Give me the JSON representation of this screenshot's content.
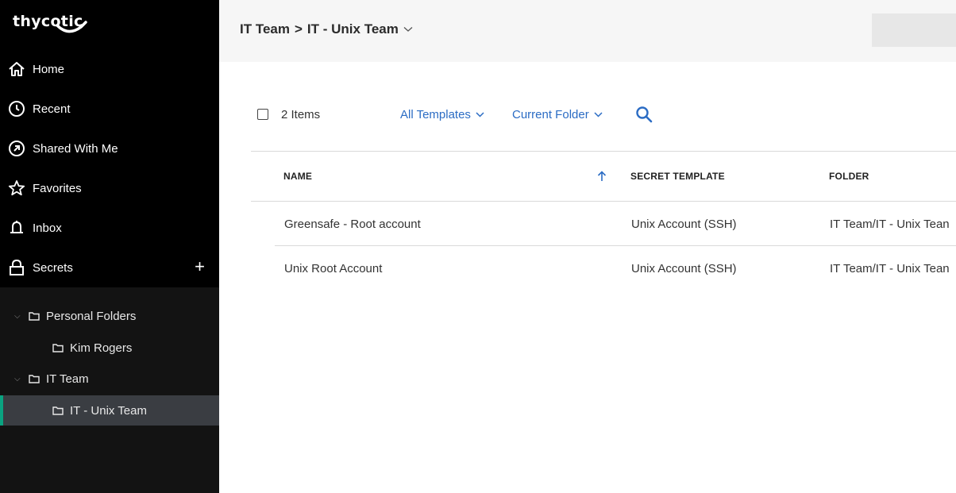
{
  "app": {
    "logo_text": "thycotic"
  },
  "sidebar": {
    "nav": [
      {
        "label": "Home",
        "icon": "home-icon"
      },
      {
        "label": "Recent",
        "icon": "clock-icon"
      },
      {
        "label": "Shared With Me",
        "icon": "shared-icon"
      },
      {
        "label": "Favorites",
        "icon": "star-icon"
      },
      {
        "label": "Inbox",
        "icon": "bell-icon"
      },
      {
        "label": "Secrets",
        "icon": "lock-icon",
        "action": "+"
      }
    ],
    "tree": [
      {
        "label": "Personal Folders",
        "expanded": true
      },
      {
        "label": "Kim Rogers"
      },
      {
        "label": "IT Team",
        "expanded": true
      },
      {
        "label": "IT - Unix Team",
        "selected": true
      }
    ],
    "accent_color": "#0aa380"
  },
  "header": {
    "breadcrumb": [
      "IT Team",
      "IT - Unix Team"
    ],
    "separator": ">"
  },
  "toolbar": {
    "item_count": "2 Items",
    "filter_templates": "All Templates",
    "filter_folder": "Current Folder",
    "link_color": "#2b6cc4"
  },
  "table": {
    "columns": [
      "NAME",
      "SECRET TEMPLATE",
      "FOLDER"
    ],
    "sorted_column": "NAME",
    "sort_direction": "ascending",
    "rows": [
      {
        "name": "Greensafe - Root account",
        "template": "Unix Account (SSH)",
        "folder": "IT Team/IT - Unix Tean"
      },
      {
        "name": "Unix Root Account",
        "template": "Unix Account (SSH)",
        "folder": "IT Team/IT - Unix Tean"
      }
    ]
  }
}
